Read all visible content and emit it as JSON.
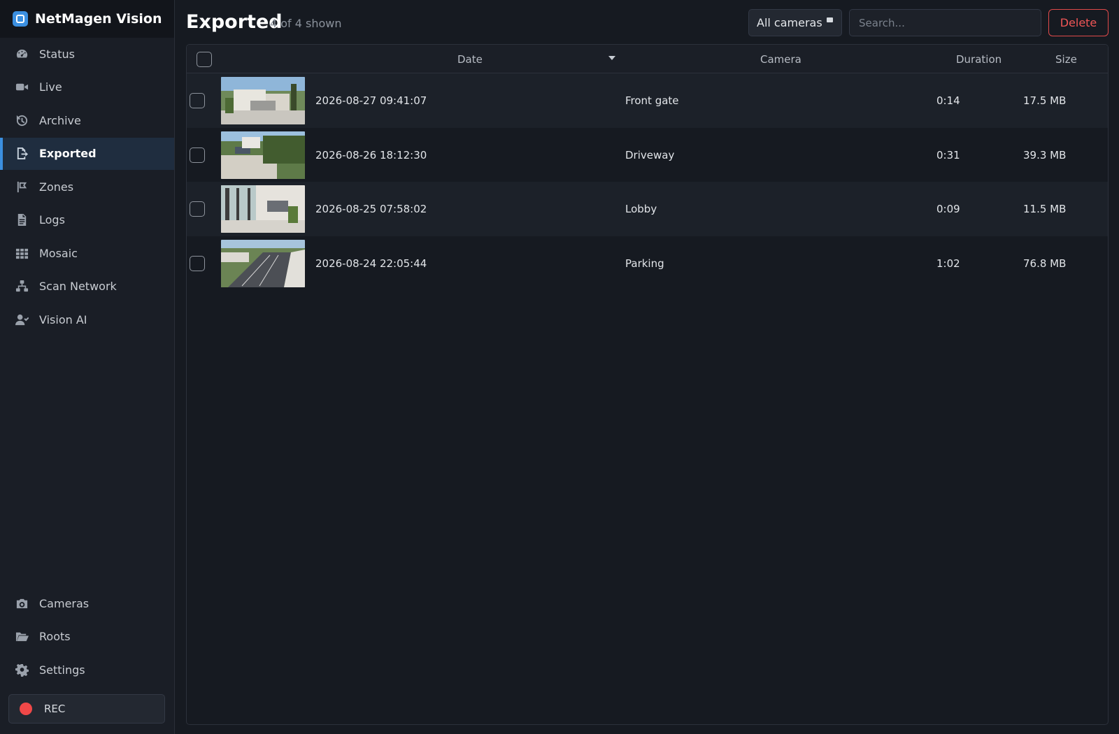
{
  "app": {
    "title": "NetMagen Vision"
  },
  "sidebar": {
    "items": [
      {
        "label": "Status",
        "icon": "gauge-icon"
      },
      {
        "label": "Live",
        "icon": "video-camera-icon"
      },
      {
        "label": "Archive",
        "icon": "history-icon"
      },
      {
        "label": "Exported",
        "icon": "file-export-icon",
        "active": true
      },
      {
        "label": "Zones",
        "icon": "flag-icon"
      },
      {
        "label": "Logs",
        "icon": "document-icon"
      },
      {
        "label": "Mosaic",
        "icon": "grid-icon"
      },
      {
        "label": "Scan Network",
        "icon": "network-icon"
      },
      {
        "label": "Vision AI",
        "icon": "user-check-icon"
      }
    ],
    "bottom_items": [
      {
        "label": "Cameras",
        "icon": "camera-icon"
      },
      {
        "label": "Roots",
        "icon": "folder-open-icon"
      },
      {
        "label": "Settings",
        "icon": "gear-icon"
      }
    ],
    "rec": {
      "label": "REC",
      "color": "#f04848"
    }
  },
  "header": {
    "title": "Exported",
    "count": "4 of 4 shown",
    "camera_filter": "All cameras",
    "search_placeholder": "Search...",
    "delete_label": "Delete"
  },
  "table": {
    "columns": {
      "date": "Date",
      "camera": "Camera",
      "duration": "Duration",
      "size": "Size"
    },
    "rows": [
      {
        "date": "2026-08-27 09:41:07",
        "camera": "Front gate",
        "duration": "0:14",
        "size": "17.5 MB"
      },
      {
        "date": "2026-08-26 18:12:30",
        "camera": "Driveway",
        "duration": "0:31",
        "size": "39.3 MB"
      },
      {
        "date": "2026-08-25 07:58:02",
        "camera": "Lobby",
        "duration": "0:09",
        "size": "11.5 MB"
      },
      {
        "date": "2026-08-24 22:05:44",
        "camera": "Parking",
        "duration": "1:02",
        "size": "76.8 MB"
      }
    ]
  },
  "colors": {
    "accent": "#3b8fe0",
    "danger": "#f05656",
    "background": "#161a21"
  }
}
